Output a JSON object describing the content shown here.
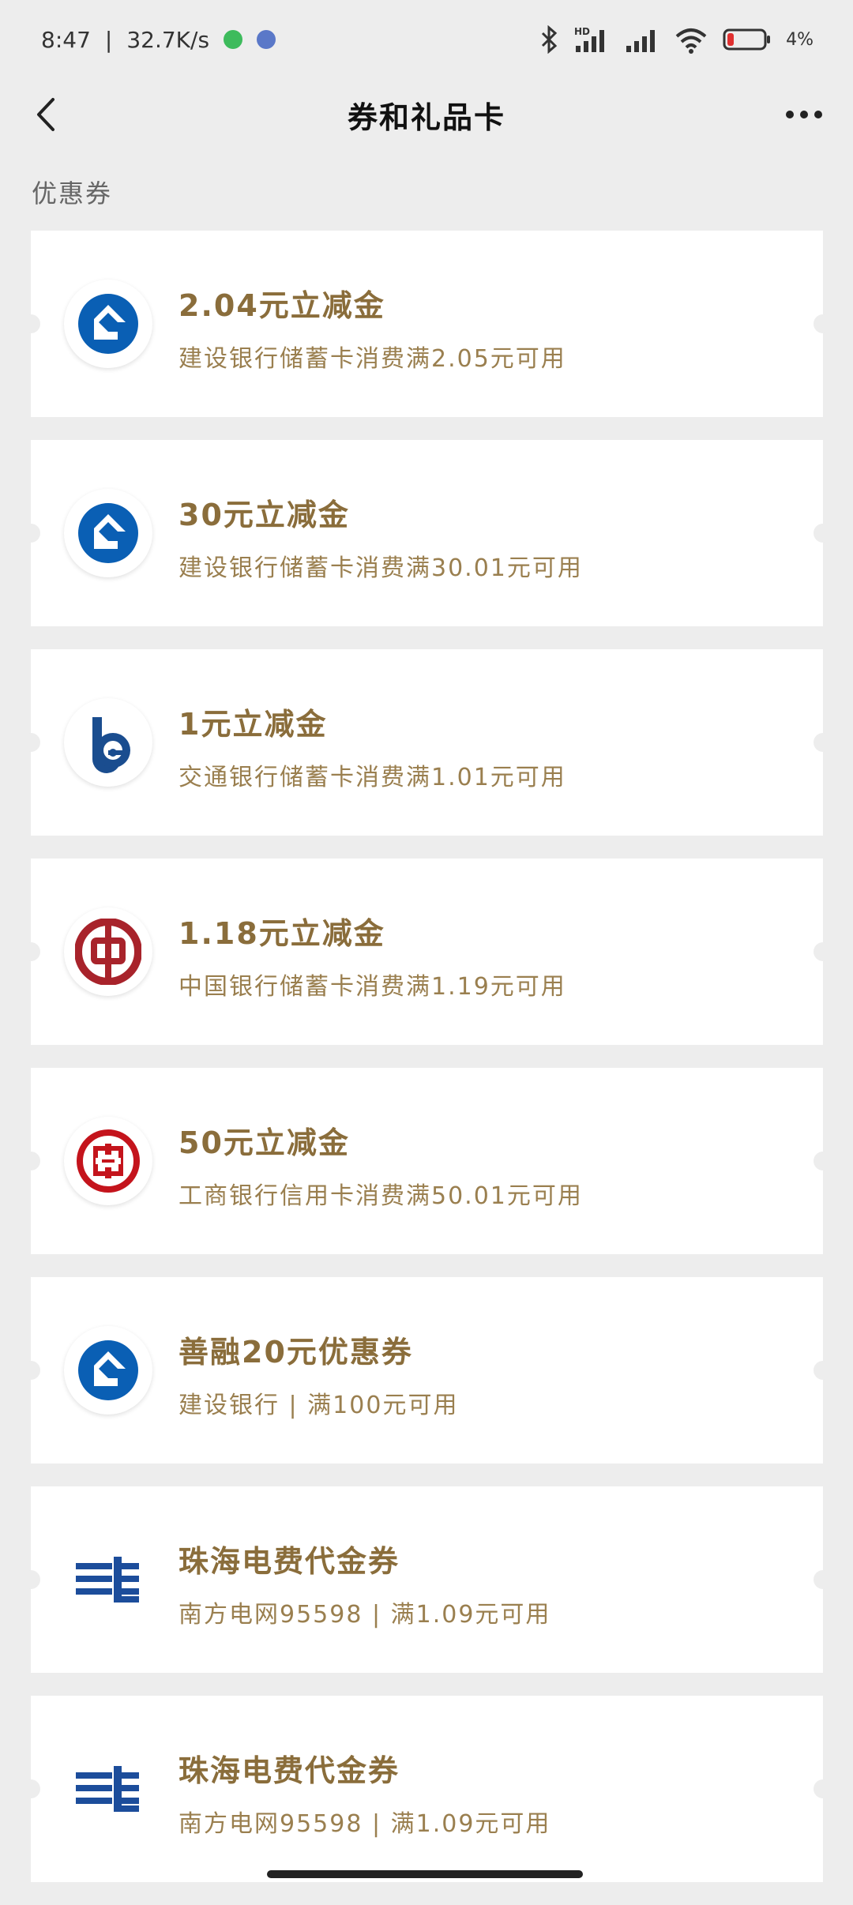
{
  "status": {
    "time": "8:47",
    "speed": "32.7K/s",
    "battery": "4%",
    "dot1_color": "#3dbb5c",
    "dot2_color": "#5a78c8",
    "battery_color": "#e03030"
  },
  "header": {
    "title": "券和礼品卡"
  },
  "section": {
    "label": "优惠券"
  },
  "cards": [
    {
      "logo": "ccb-logo",
      "title": "2.04元立减金",
      "subtitle": "建设银行储蓄卡消费满2.05元可用"
    },
    {
      "logo": "ccb-logo",
      "title": "30元立减金",
      "subtitle": "建设银行储蓄卡消费满30.01元可用"
    },
    {
      "logo": "bocom-logo",
      "title": "1元立减金",
      "subtitle": "交通银行储蓄卡消费满1.01元可用"
    },
    {
      "logo": "boc-logo",
      "title": "1.18元立减金",
      "subtitle": "中国银行储蓄卡消费满1.19元可用"
    },
    {
      "logo": "icbc-logo",
      "title": "50元立减金",
      "subtitle": "工商银行信用卡消费满50.01元可用"
    },
    {
      "logo": "ccb-logo",
      "title": "善融20元优惠券",
      "subtitle": "建设银行 | 满100元可用"
    },
    {
      "logo": "csg-logo",
      "title": "珠海电费代金券",
      "subtitle": "南方电网95598 | 满1.09元可用"
    },
    {
      "logo": "csg-logo",
      "title": "珠海电费代金券",
      "subtitle": "南方电网95598 | 满1.09元可用"
    }
  ],
  "colors": {
    "ccb_blue": "#0a5fb4",
    "bocom_blue": "#1a4d8f",
    "boc_red": "#a8232b",
    "icbc_red": "#c4141c",
    "csg_blue": "#1c4d9b",
    "coupon_text": "#8a6d3b"
  }
}
